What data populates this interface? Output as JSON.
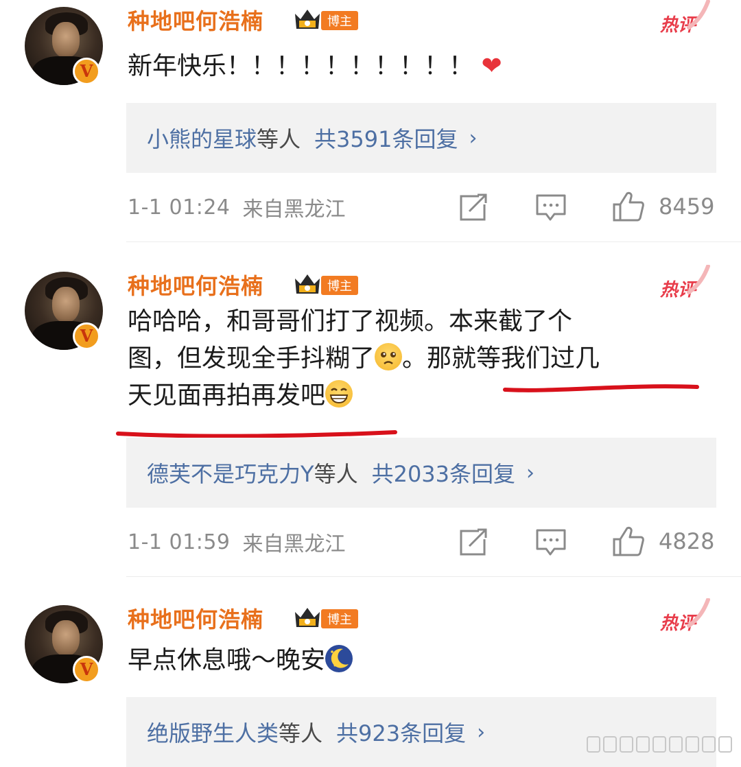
{
  "comments": [
    {
      "username": "种地吧何浩楠",
      "tag": "博主",
      "hot_label": "热评",
      "text_lines": [
        "新年快乐！！！！！！！！！！"
      ],
      "reply_user": "小熊的星球",
      "reply_etc": "等人",
      "reply_count": "共3591条回复",
      "time": "1-1 01:24",
      "location": "来自黑龙江",
      "likes": "8459"
    },
    {
      "username": "种地吧何浩楠",
      "tag": "博主",
      "hot_label": "热评",
      "text_lines": [
        "哈哈哈，和哥哥们打了视频。本来截了个",
        "图，但发现全手抖糊了",
        "。那就等我们过几",
        "天见面再拍再发吧"
      ],
      "reply_user": "德芙不是巧克力Y",
      "reply_etc": "等人",
      "reply_count": "共2033条回复",
      "time": "1-1 01:59",
      "location": "来自黑龙江",
      "likes": "4828"
    },
    {
      "username": "种地吧何浩楠",
      "tag": "博主",
      "hot_label": "热评",
      "text_lines": [
        "早点休息哦～晚安"
      ],
      "reply_user": "绝版野生人类",
      "reply_etc": "等人",
      "reply_count": "共923条回复"
    }
  ],
  "icons": {
    "verified": "v-badge-icon",
    "crown": "crown-icon",
    "share": "share-icon",
    "comment": "comment-icon",
    "like": "thumbs-up-icon",
    "chevron": "chevron-right-icon",
    "heart": "heart-emoji",
    "sad": "sad-face-emoji",
    "grin": "grin-emoji",
    "moon": "moon-emoji"
  },
  "colors": {
    "username": "#e8701c",
    "hot": "#e83c4a",
    "link": "#4d6fa3",
    "meta": "#8a8a8a",
    "underline": "#d8111b"
  },
  "heart_glyph": "❤",
  "chevron_glyph": "›",
  "verified_letter": "V"
}
